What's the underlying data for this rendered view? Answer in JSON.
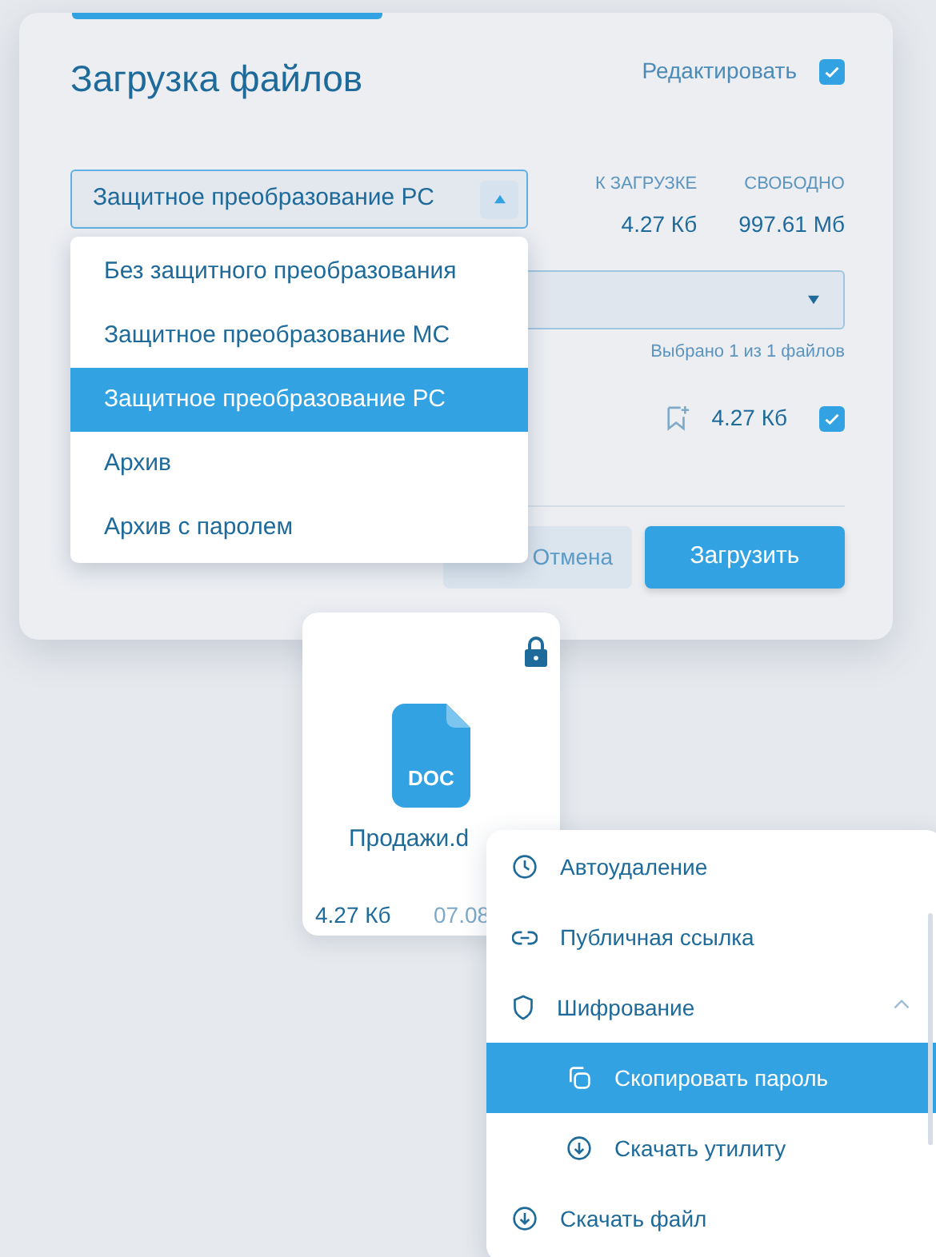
{
  "dialog": {
    "title": "Загрузка файлов",
    "edit": {
      "label": "Редактировать",
      "checked": true
    },
    "protection_select": {
      "value": "Защитное преобразование РС",
      "expanded": true
    },
    "stats": [
      {
        "label": "К ЗАГРУЗКЕ",
        "value": "4.27 Кб"
      },
      {
        "label": "СВОБОДНО",
        "value": "997.61 Мб"
      }
    ],
    "selection_note": "Выбрано 1 из 1 файлов",
    "file_row": {
      "size": "4.27 Кб",
      "checked": true
    },
    "buttons": [
      {
        "label": "Отмена",
        "kind": "secondary"
      },
      {
        "label": "Загрузить",
        "kind": "primary"
      }
    ]
  },
  "dropdown": [
    {
      "label": "Без защитного преобразования",
      "selected": false
    },
    {
      "label": "Защитное преобразование МС",
      "selected": false
    },
    {
      "label": "Защитное преобразование РС",
      "selected": true
    },
    {
      "label": "Архив",
      "selected": false
    },
    {
      "label": "Архив с паролем",
      "selected": false
    }
  ],
  "file_card": {
    "locked": true,
    "type_label": "DOC",
    "name": "Продажи.d",
    "size": "4.27 Кб",
    "date": "07.08"
  },
  "context_menu": [
    {
      "label": "Автоудаление",
      "selected": false
    },
    {
      "label": "Публичная ссылка",
      "selected": false
    },
    {
      "label": "Шифрование",
      "selected": false,
      "expanded": true,
      "children": [
        {
          "label": "Скопировать пароль",
          "selected": true
        },
        {
          "label": "Скачать утилиту",
          "selected": false
        }
      ]
    },
    {
      "label": "Скачать файл",
      "selected": false
    }
  ]
}
